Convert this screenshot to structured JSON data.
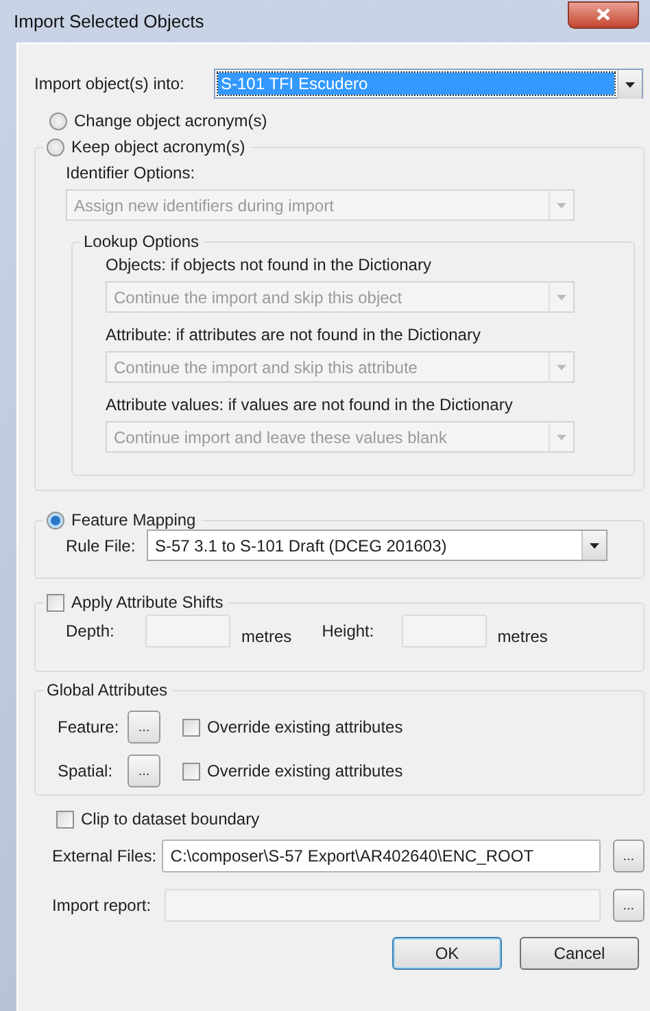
{
  "window": {
    "title": "Import Selected Objects"
  },
  "import_into": {
    "label": "Import object(s) into:",
    "value": "S-101 TFI Escudero",
    "focused": true
  },
  "acronym_options": [
    {
      "label": "Change object acronym(s)",
      "selected": false
    },
    {
      "label": "Keep object acronym(s)",
      "selected": false
    }
  ],
  "identifier_options": {
    "label": "Identifier Options:",
    "value": "Assign new identifiers during import",
    "disabled": true
  },
  "lookup_options": {
    "title": "Lookup Options",
    "items": [
      {
        "label": "Objects: if objects not found in the Dictionary",
        "value": "Continue the import and skip this object",
        "disabled": true
      },
      {
        "label": "Attribute: if attributes are not found in the Dictionary",
        "value": "Continue the import and skip this attribute",
        "disabled": true
      },
      {
        "label": "Attribute values: if values are not found in the Dictionary",
        "value": "Continue import and leave these values blank",
        "disabled": true
      }
    ]
  },
  "feature_mapping": {
    "label": "Feature  Mapping",
    "selected": true,
    "rule_file": {
      "label": "Rule File:",
      "value": "S-57 3.1 to S-101 Draft (DCEG 201603)"
    }
  },
  "attribute_shifts": {
    "label": "Apply Attribute Shifts",
    "checked": false,
    "fields": [
      {
        "label": "Depth:",
        "unit": "metres"
      },
      {
        "label": "Height:",
        "unit": "metres"
      }
    ]
  },
  "global_attributes": {
    "title": "Global Attributes",
    "rows": [
      {
        "label": "Feature:",
        "button": "...",
        "override": {
          "label": "Override existing attributes",
          "checked": false
        }
      },
      {
        "label": "Spatial:",
        "button": "...",
        "override": {
          "label": "Override existing attributes",
          "checked": false
        }
      }
    ]
  },
  "clip": {
    "label": "Clip to dataset boundary",
    "checked": false
  },
  "external_files": {
    "label": "External Files:",
    "value": "C:\\composer\\S-57 Export\\AR402640\\ENC_ROOT",
    "button": "..."
  },
  "import_report": {
    "label": "Import report:",
    "button": "..."
  },
  "buttons": [
    {
      "label": "OK",
      "default": true
    },
    {
      "label": "Cancel",
      "default": false
    }
  ]
}
